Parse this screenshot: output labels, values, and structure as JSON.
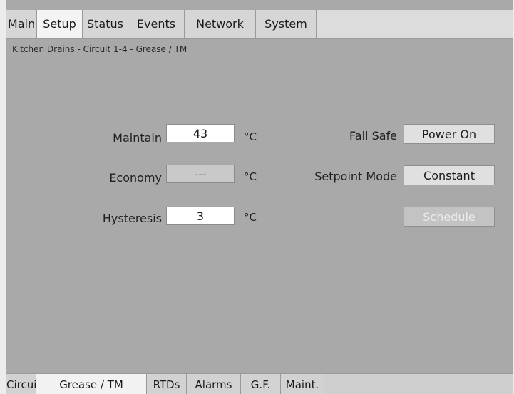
{
  "top_tabs": [
    {
      "label": "Main"
    },
    {
      "label": "Setup",
      "active": true
    },
    {
      "label": "Status"
    },
    {
      "label": "Events"
    },
    {
      "label": "Network"
    },
    {
      "label": "System"
    }
  ],
  "group_title": "Kitchen Drains - Circuit 1-4 - Grease / TM",
  "form": {
    "maintain": {
      "label": "Maintain",
      "value": "43",
      "unit": "°C"
    },
    "economy": {
      "label": "Economy",
      "value": "---",
      "unit": "°C"
    },
    "hysteresis": {
      "label": "Hysteresis",
      "value": "3",
      "unit": "°C"
    },
    "fail_safe": {
      "label": "Fail Safe",
      "button": "Power On"
    },
    "setpoint_mode": {
      "label": "Setpoint Mode",
      "button": "Constant"
    },
    "schedule": {
      "button": "Schedule"
    }
  },
  "bottom_tabs": [
    {
      "label": "Circuit"
    },
    {
      "label": "Grease / TM",
      "active": true
    },
    {
      "label": "RTDs"
    },
    {
      "label": "Alarms"
    },
    {
      "label": "G.F."
    },
    {
      "label": "Maint."
    }
  ]
}
